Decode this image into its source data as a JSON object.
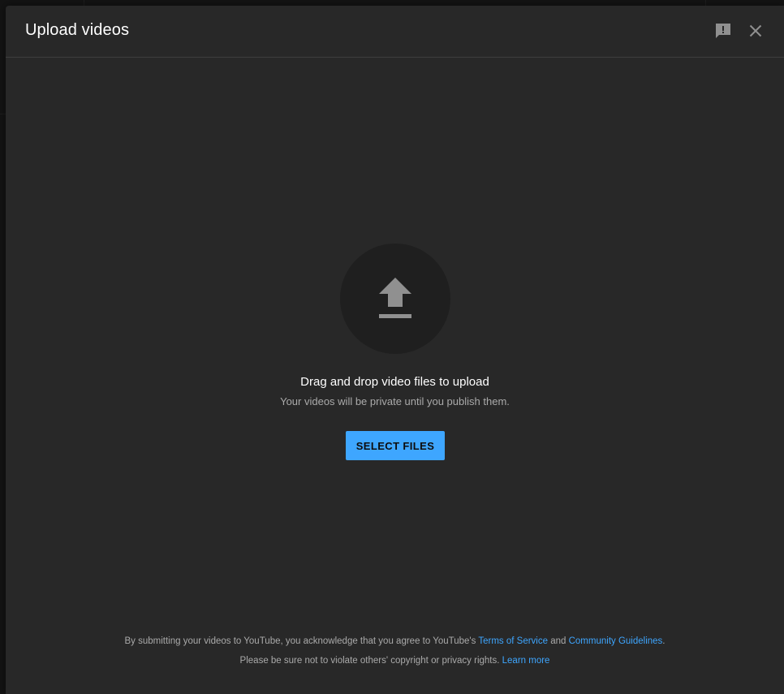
{
  "dialog": {
    "title": "Upload videos",
    "header_icons": [
      "feedback-icon",
      "close-icon"
    ]
  },
  "upload": {
    "icon": "upload-icon",
    "drop_text": "Drag and drop video files to upload",
    "private_text": "Your videos will be private until you publish them.",
    "select_button": "SELECT FILES"
  },
  "footer": {
    "line1_prefix": "By submitting your videos to YouTube, you acknowledge that you agree to YouTube's",
    "terms_link": "Terms of Service",
    "and_text": "and",
    "guidelines_link": "Community Guidelines",
    "line1_suffix": ".",
    "line2_text": "Please be sure not to violate others' copyright or privacy rights.",
    "learn_more_link": "Learn more"
  },
  "colors": {
    "dialog_bg": "#282828",
    "accent": "#3ea6ff",
    "primary_text": "#ffffff",
    "secondary_text": "#aaaaaa",
    "icon": "#909090"
  }
}
